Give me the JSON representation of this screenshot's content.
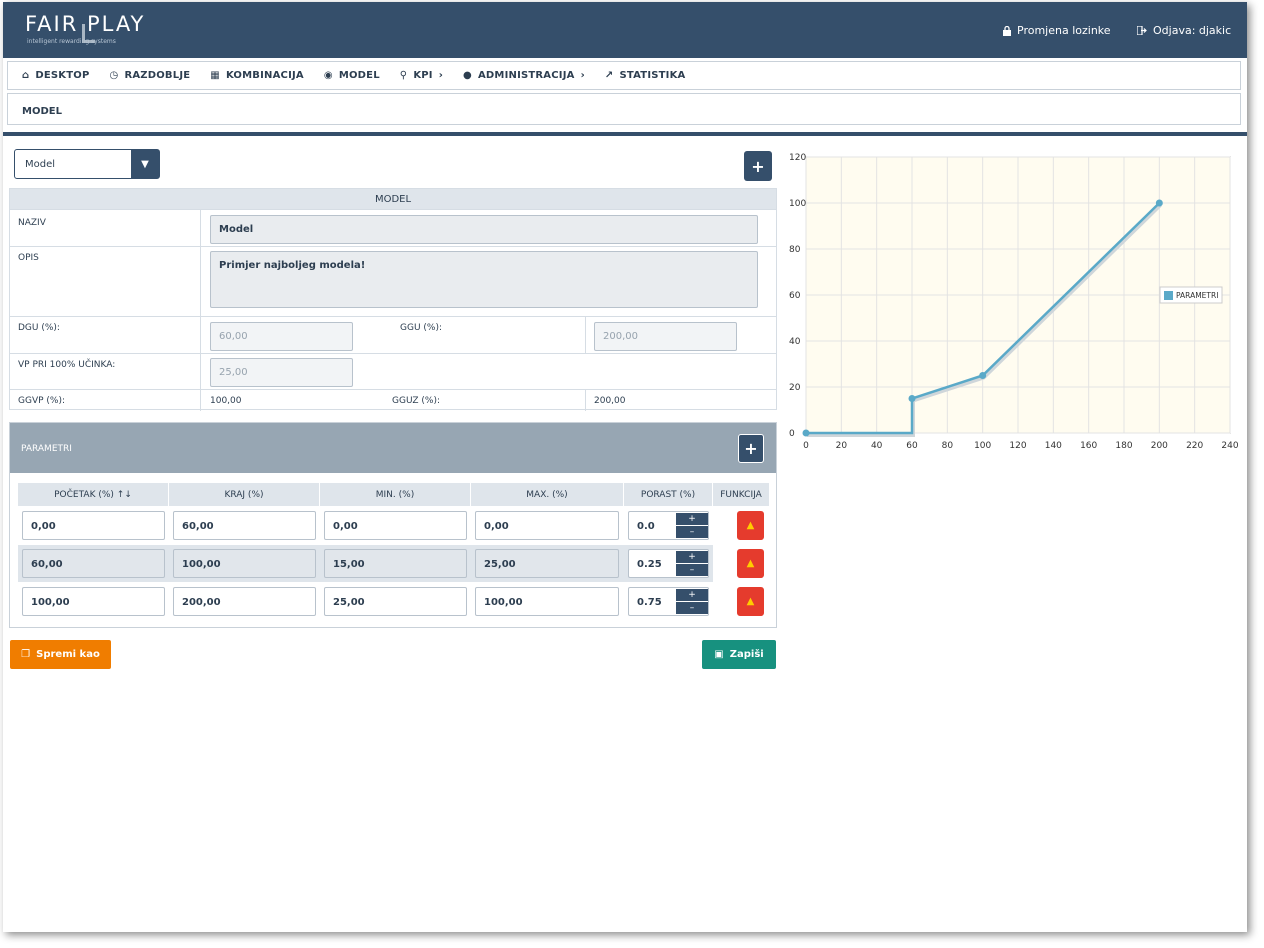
{
  "header": {
    "logo": "FAIR PLAY",
    "logo_tagline": "intelligent rewarding systems",
    "change_password": "Promjena lozinke",
    "logout": "Odjava: djakic"
  },
  "nav": {
    "items": [
      {
        "label": "DESKTOP",
        "icon": "home-icon"
      },
      {
        "label": "RAZDOBLJE",
        "icon": "clock-icon"
      },
      {
        "label": "KOMBINACIJA",
        "icon": "cubes-icon"
      },
      {
        "label": "MODEL",
        "icon": "cube-icon"
      },
      {
        "label": "KPI",
        "icon": "lightbulb-icon"
      },
      {
        "label": "ADMINISTRACIJA",
        "icon": "user-icon"
      },
      {
        "label": "STATISTIKA",
        "icon": "line-chart-icon"
      }
    ]
  },
  "breadcrumb": "MODEL",
  "model_select": {
    "value": "Model"
  },
  "model_table": {
    "title": "MODEL",
    "naziv_label": "NAZIV",
    "naziv_value": "Model",
    "opis_label": "OPIS",
    "opis_value": "Primjer najboljeg modela!",
    "dgu_label": "DGU (%):",
    "dgu_value": "60,00",
    "ggu_label": "GGU (%):",
    "ggu_value": "200,00",
    "vp_label": "VP PRI 100% UČINKA:",
    "vp_value": "25,00",
    "ggvp_label": "GGVP (%):",
    "ggvp_value": "100,00",
    "gguz_label": "GGUZ (%):",
    "gguz_value": "200,00"
  },
  "params": {
    "title": "PARAMETRI",
    "columns": [
      "POČETAK (%)",
      "KRAJ (%)",
      "MIN. (%)",
      "MAX. (%)",
      "PORAST (%)",
      "FUNKCIJA"
    ],
    "sort_icon": "sort-icon",
    "rows": [
      {
        "start": "0,00",
        "end": "60,00",
        "min": "0,00",
        "max": "0,00",
        "porast": "0.0"
      },
      {
        "start": "60,00",
        "end": "100,00",
        "min": "15,00",
        "max": "25,00",
        "porast": "0.25"
      },
      {
        "start": "100,00",
        "end": "200,00",
        "min": "25,00",
        "max": "100,00",
        "porast": "0.75"
      }
    ]
  },
  "buttons": {
    "save_as": "Spremi kao",
    "save": "Zapiši"
  },
  "chart_data": {
    "type": "line",
    "series": [
      {
        "name": "PARAMETRI",
        "x": [
          0,
          60,
          60,
          100,
          200
        ],
        "y": [
          0,
          0,
          15,
          25,
          100
        ]
      }
    ],
    "xticks": [
      0,
      20,
      40,
      60,
      80,
      100,
      120,
      140,
      160,
      180,
      200,
      220,
      240
    ],
    "yticks": [
      0,
      20,
      40,
      60,
      80,
      100,
      120
    ],
    "xlim": [
      0,
      240
    ],
    "ylim": [
      0,
      120
    ],
    "grid": true,
    "legend": "right",
    "colors": {
      "line": "#5aa9c8",
      "bg": "#fffcf0",
      "grid": "#e3e3e3"
    }
  }
}
